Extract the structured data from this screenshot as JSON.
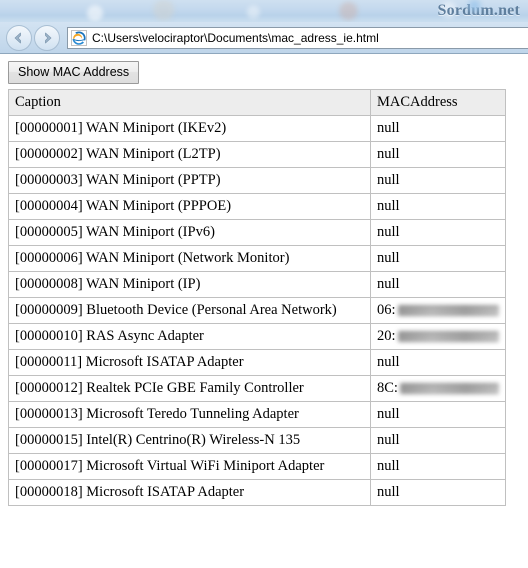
{
  "window": {
    "watermark": "Sordum.net"
  },
  "navigation": {
    "back_label": "Back",
    "forward_label": "Forward",
    "address_value": "C:\\Users\\velociraptor\\Documents\\mac_adress_ie.html",
    "address_placeholder": "",
    "site_icon": "internet-explorer-icon"
  },
  "page": {
    "button_label": "Show MAC Address",
    "table": {
      "columns": [
        "Caption",
        "MACAddress"
      ],
      "rows": [
        {
          "caption": "[00000001] WAN Miniport (IKEv2)",
          "mac": "null",
          "redacted": false
        },
        {
          "caption": "[00000002] WAN Miniport (L2TP)",
          "mac": "null",
          "redacted": false
        },
        {
          "caption": "[00000003] WAN Miniport (PPTP)",
          "mac": "null",
          "redacted": false
        },
        {
          "caption": "[00000004] WAN Miniport (PPPOE)",
          "mac": "null",
          "redacted": false
        },
        {
          "caption": "[00000005] WAN Miniport (IPv6)",
          "mac": "null",
          "redacted": false
        },
        {
          "caption": "[00000006] WAN Miniport (Network Monitor)",
          "mac": "null",
          "redacted": false
        },
        {
          "caption": "[00000008] WAN Miniport (IP)",
          "mac": "null",
          "redacted": false
        },
        {
          "caption": "[00000009] Bluetooth Device (Personal Area Network)",
          "mac": "06:",
          "redacted": true
        },
        {
          "caption": "[00000010] RAS Async Adapter",
          "mac": "20:",
          "redacted": true
        },
        {
          "caption": "[00000011] Microsoft ISATAP Adapter",
          "mac": "null",
          "redacted": false
        },
        {
          "caption": "[00000012] Realtek PCIe GBE Family Controller",
          "mac": "8C:",
          "redacted": true
        },
        {
          "caption": "[00000013] Microsoft Teredo Tunneling Adapter",
          "mac": "null",
          "redacted": false
        },
        {
          "caption": "[00000015] Intel(R) Centrino(R) Wireless-N 135",
          "mac": "null",
          "redacted": false
        },
        {
          "caption": "[00000017] Microsoft Virtual WiFi Miniport Adapter",
          "mac": "null",
          "redacted": false
        },
        {
          "caption": "[00000018] Microsoft ISATAP Adapter",
          "mac": "null",
          "redacted": false
        }
      ]
    }
  }
}
